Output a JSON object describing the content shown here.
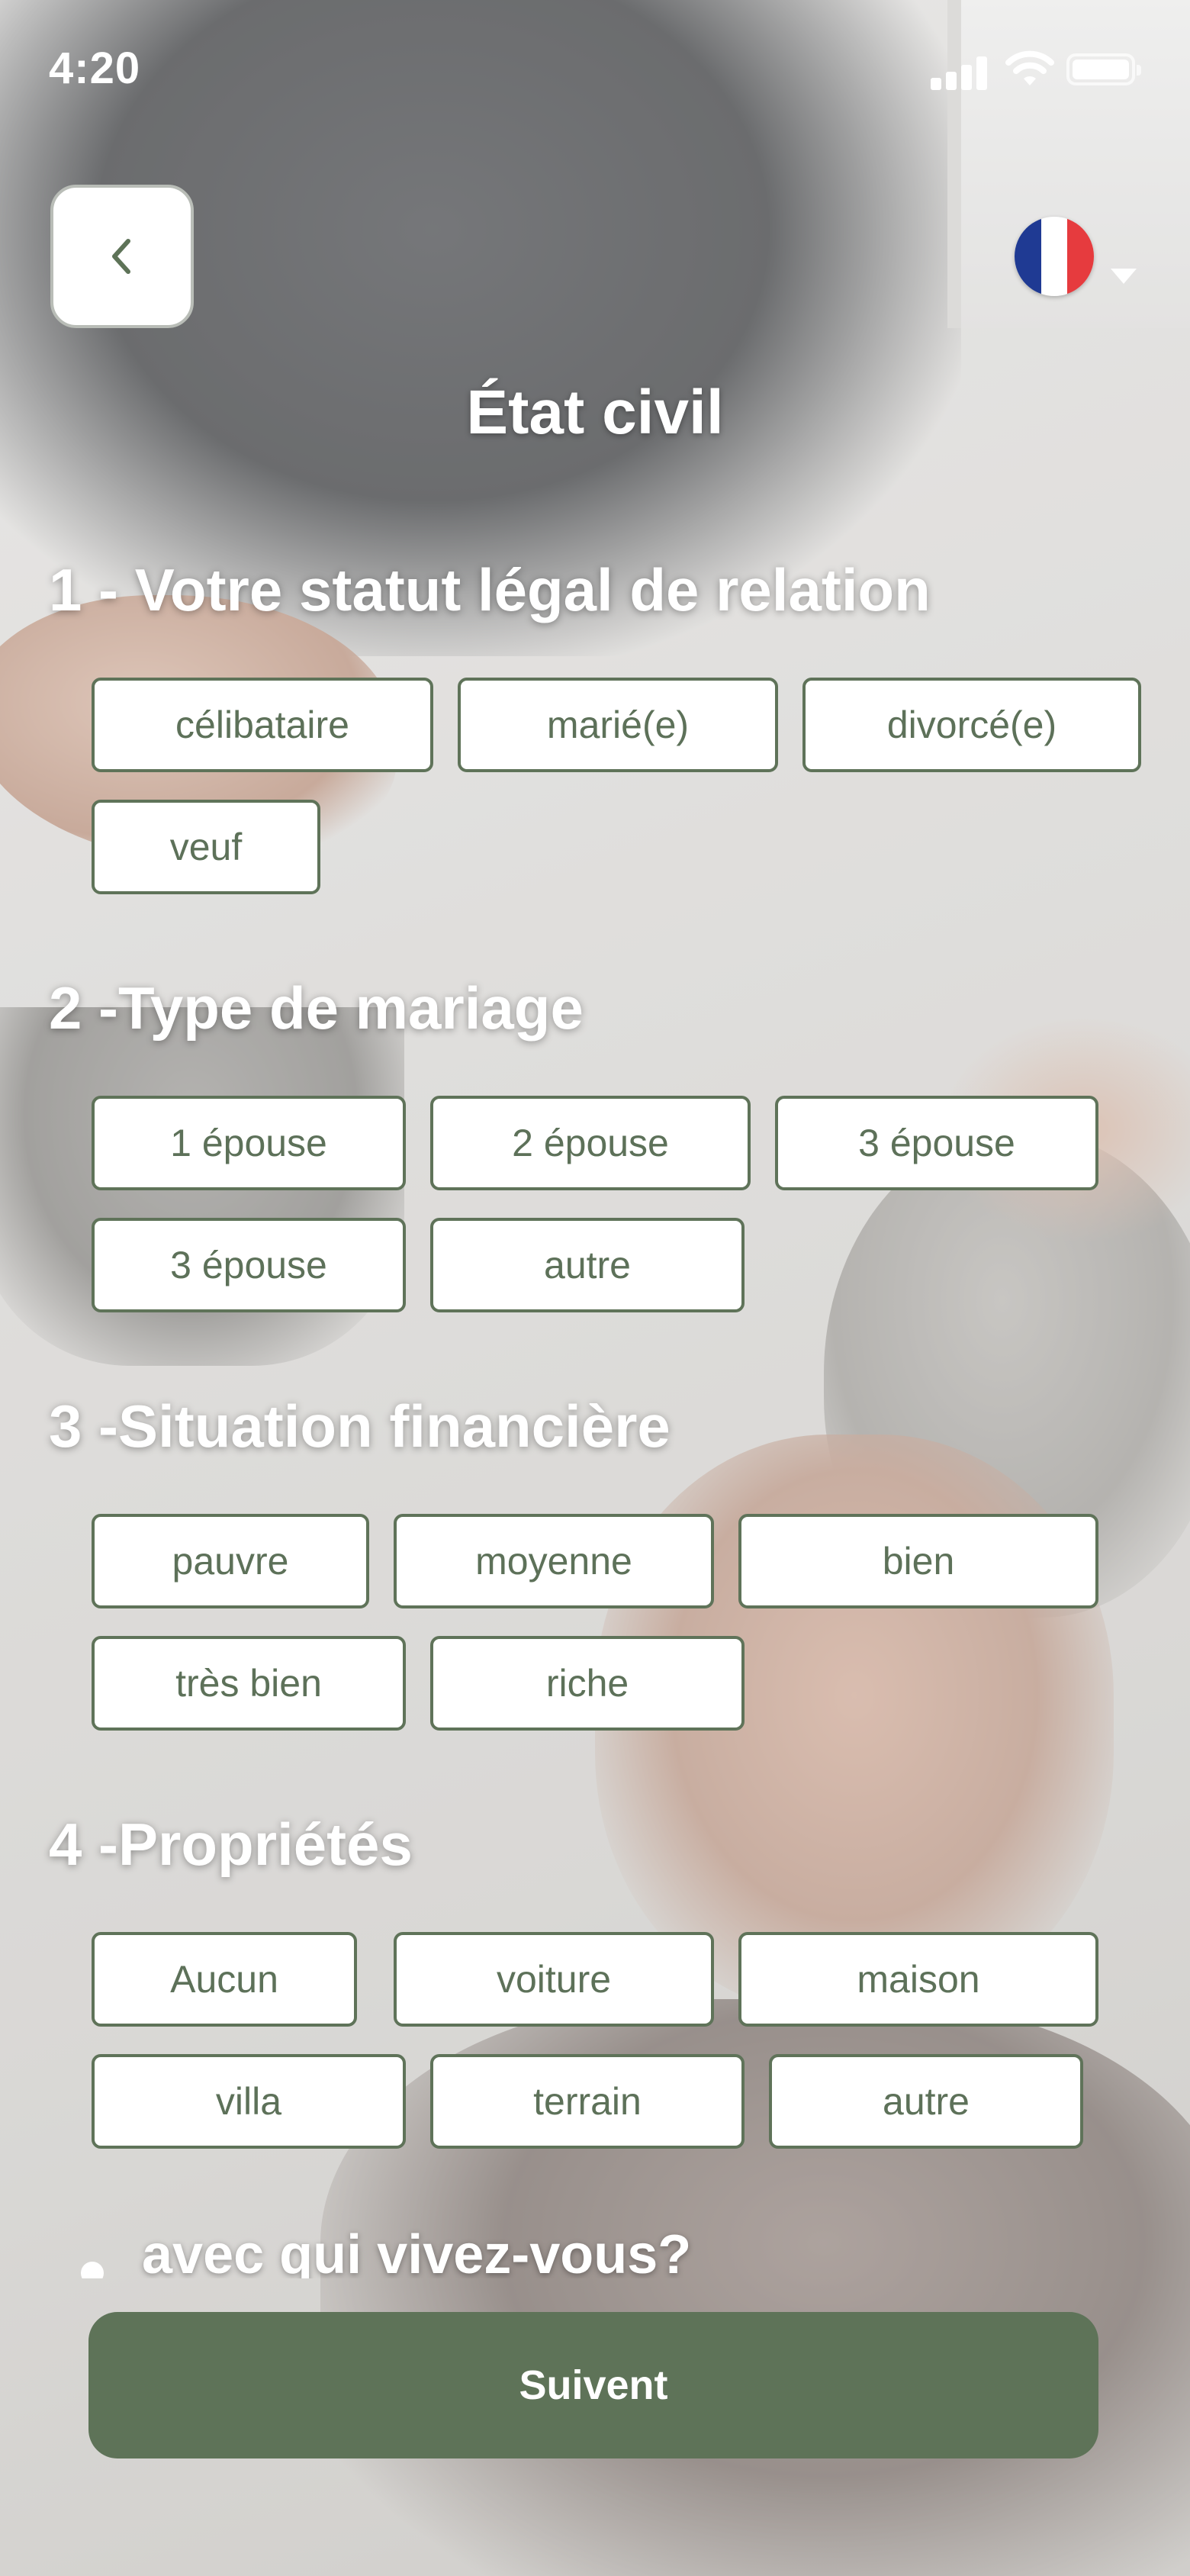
{
  "status_bar": {
    "time": "4:20"
  },
  "header": {
    "title": "État civil",
    "language_flag": "france-flag"
  },
  "colors": {
    "accent": "#5e7358",
    "chip_border": "#5f7359",
    "chip_text": "#5d7159",
    "flag_blue": "#1f3a93",
    "flag_red": "#e63b3e"
  },
  "sections": [
    {
      "title": "1 - Votre statut légal de relation",
      "options": [
        "célibataire",
        "marié(e)",
        "divorcé(e)",
        "veuf"
      ]
    },
    {
      "title": "2 -Type de mariage",
      "options": [
        "1 épouse",
        "2 épouse",
        "3 épouse",
        "3 épouse",
        "autre"
      ]
    },
    {
      "title": "3 -Situation financière",
      "options": [
        "pauvre",
        "moyenne",
        "bien",
        "très bien",
        "riche"
      ]
    },
    {
      "title": "4 -Propriétés",
      "options": [
        "Aucun",
        "voiture",
        "maison",
        "villa",
        "terrain",
        "autre"
      ]
    }
  ],
  "next_question": "avec qui vivez-vous?",
  "submit_label": "Suivent"
}
